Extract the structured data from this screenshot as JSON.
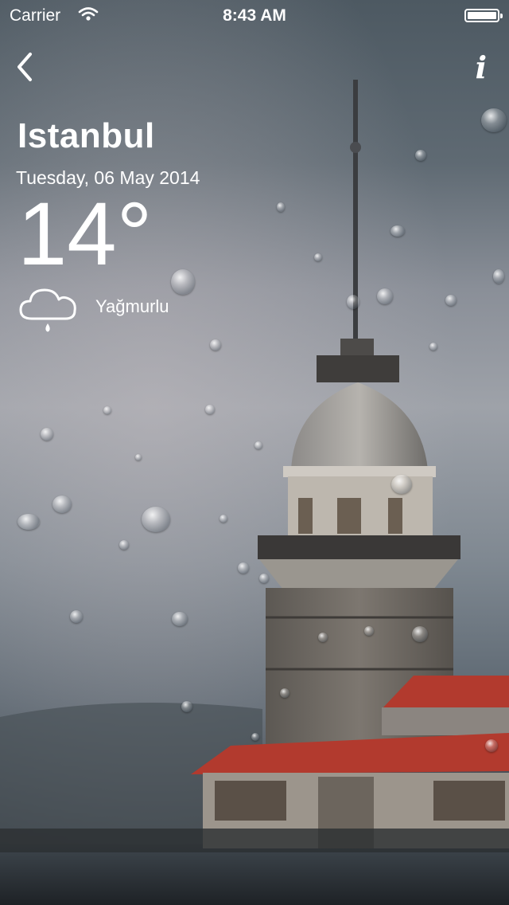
{
  "status_bar": {
    "carrier": "Carrier",
    "time": "8:43 AM"
  },
  "nav": {
    "back_icon": "chevron-left-icon",
    "info_icon": "info-icon",
    "info_label": "i"
  },
  "weather": {
    "city": "Istanbul",
    "date": "Tuesday, 06 May 2014",
    "temperature": "14°",
    "condition": "Yağmurlu",
    "condition_icon": "rain-cloud-icon"
  },
  "colors": {
    "tower_roof": "#b23a2e",
    "tower_stone": "#6d6862"
  }
}
